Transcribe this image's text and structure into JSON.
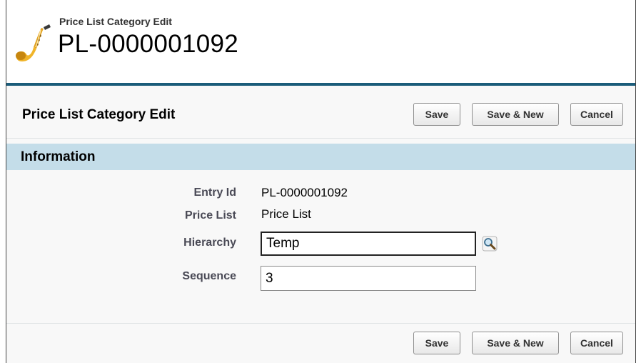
{
  "header": {
    "subtitle": "Price List Category Edit",
    "title": "PL-0000001092",
    "icon": "saxophone-icon"
  },
  "edit_block": {
    "title": "Price List Category Edit",
    "buttons": {
      "save": "Save",
      "save_new": "Save & New",
      "cancel": "Cancel"
    }
  },
  "section": {
    "title": "Information"
  },
  "fields": {
    "entry_id": {
      "label": "Entry Id",
      "value": "PL-0000001092"
    },
    "price_list": {
      "label": "Price List",
      "value": "Price List"
    },
    "hierarchy": {
      "label": "Hierarchy",
      "value": "Temp",
      "lookup_icon": "lookup-magnifier-icon"
    },
    "sequence": {
      "label": "Sequence",
      "value": "3"
    }
  },
  "colors": {
    "block_top_border": "#1b5c7a",
    "section_header_bg": "#c4dde9",
    "block_bg": "#f8f8f8",
    "label_text": "#4a4a56"
  }
}
